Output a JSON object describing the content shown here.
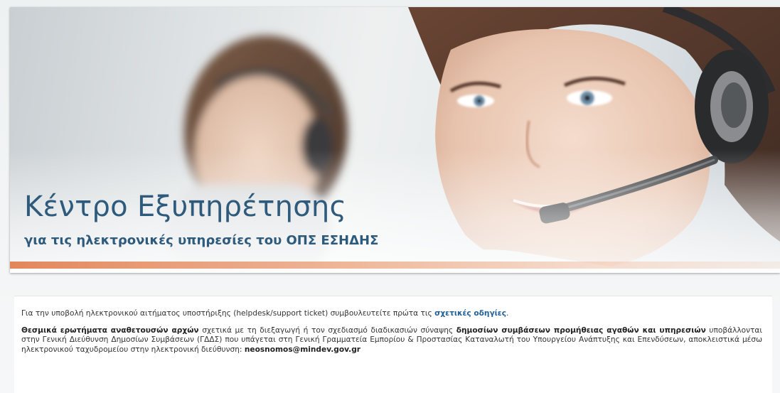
{
  "banner": {
    "title": "Κέντρο Εξυπηρέτησης",
    "subtitle": "για τις ηλεκτρονικές υπηρεσίες του ΟΠΣ ΕΣΗΔΗΣ"
  },
  "intro": {
    "text_before": "Για την υποβολή ηλεκτρονικού αιτήματος υποστήριξης (helpdesk/support ticket) συμβουλευτείτε πρώτα τις ",
    "link_label": "σχετικές οδηγίες",
    "text_after": "."
  },
  "notice": {
    "bold_lead": "Θεσμικά ερωτήματα αναθετουσών αρχών",
    "text_1": " σχετικά με τη διεξαγωγή ή τον σχεδιασμό διαδικασιών σύναψης ",
    "bold_middle": "δημοσίων συμβάσεων προμήθειας αγαθών και υπηρεσιών",
    "text_2": " υποβάλλονται στην Γενική Διεύθυνση Δημοσίων Συμβάσεων (ΓΔΔΣ) που υπάγεται στη Γενική Γραμματεία Εμπορίου & Προστασίας Καταναλωτή του Υπουργείου Ανάπτυξης και Επενδύσεων, αποκλειστικά μέσω ηλεκτρονικού ταχυδρομείου στην ηλεκτρονική διεύθυνση: ",
    "email": "neosnomos@mindev.gov.gr"
  },
  "colors": {
    "title": "#2e5a7c",
    "link": "#1f5f95",
    "accent_stripe": "#e07a4a"
  }
}
